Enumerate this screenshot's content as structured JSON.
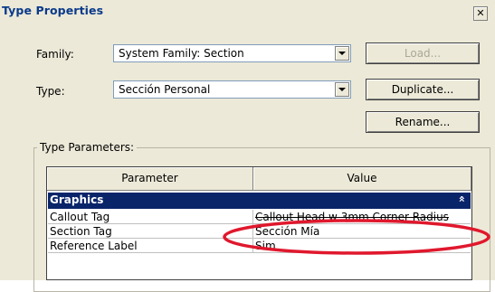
{
  "window": {
    "title": "Type Properties",
    "close_glyph": "✕"
  },
  "family": {
    "label": "Family:",
    "value": "System Family: Section"
  },
  "type": {
    "label": "Type:",
    "value": "Sección Personal"
  },
  "buttons": {
    "load": "Load...",
    "duplicate": "Duplicate...",
    "rename": "Rename..."
  },
  "type_parameters": {
    "group_label": "Type Parameters:",
    "columns": [
      "Parameter",
      "Value"
    ],
    "section": {
      "name": "Graphics",
      "collapse_glyph": "»"
    },
    "rows": [
      {
        "parameter": "Callout Tag",
        "value": "Callout Head w 3mm Corner Radius"
      },
      {
        "parameter": "Section Tag",
        "value": "Sección Mía"
      },
      {
        "parameter": "Reference Label",
        "value": "Sim"
      }
    ]
  },
  "colors": {
    "highlight_ellipse": "#e0182d",
    "section_header": "#0a246a",
    "title_text": "#0a3a8a"
  }
}
